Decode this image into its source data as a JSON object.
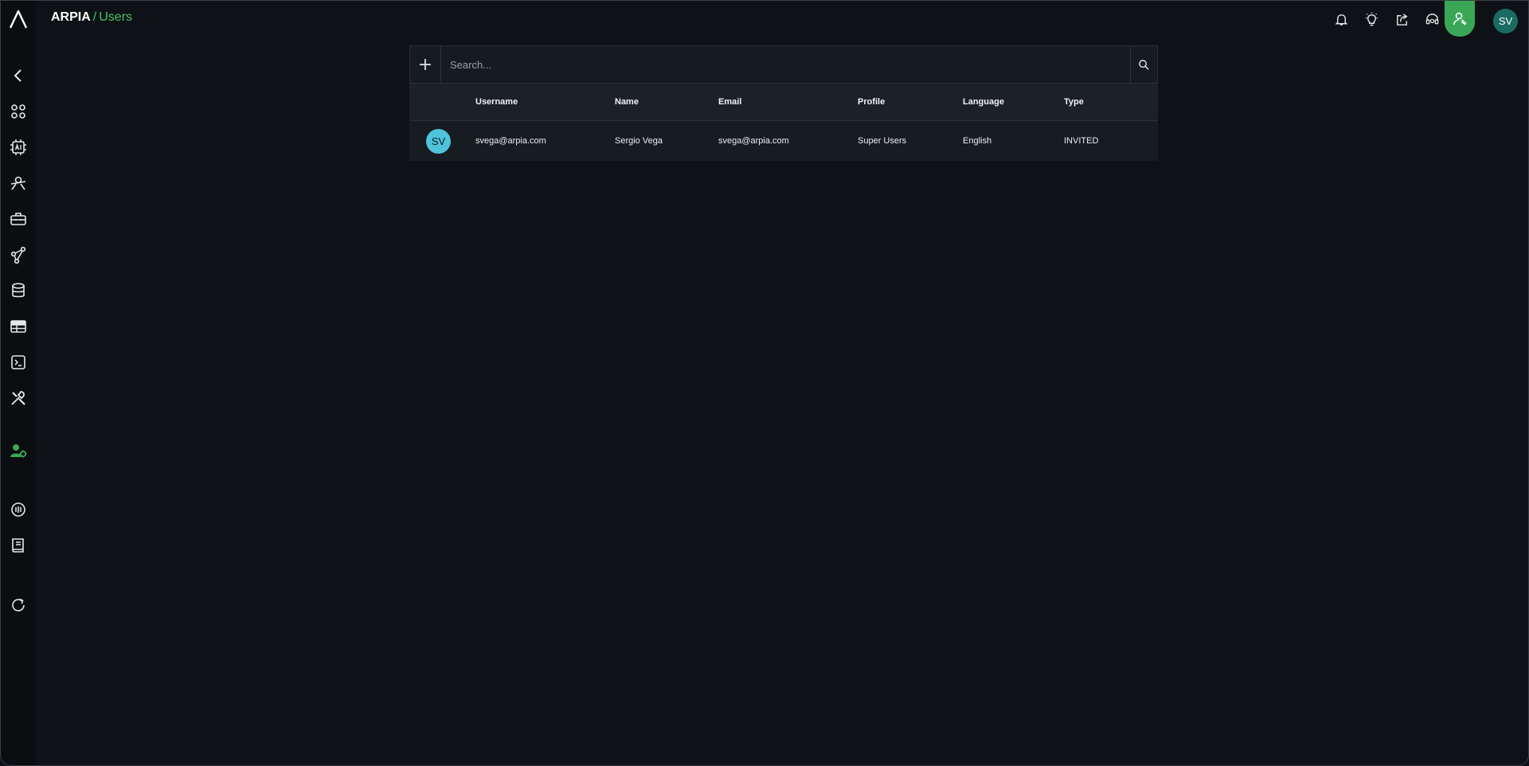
{
  "header": {
    "app_name": "ARPIA",
    "separator": "/",
    "page_name": "Users",
    "user_initials": "SV"
  },
  "accent_color": "#3aa757",
  "sidebar": {
    "items": [
      {
        "icon": "chevron-left-icon"
      },
      {
        "icon": "apps-grid-icon"
      },
      {
        "icon": "ai-chip-icon"
      },
      {
        "icon": "user-network-icon"
      },
      {
        "icon": "toolbox-icon"
      },
      {
        "icon": "graph-nodes-icon"
      },
      {
        "icon": "database-icon"
      },
      {
        "icon": "table-icon"
      },
      {
        "icon": "terminal-icon"
      },
      {
        "icon": "tools-icon"
      },
      {
        "icon": "user-settings-icon",
        "active": true
      },
      {
        "icon": "info-circle-icon"
      },
      {
        "icon": "book-icon"
      },
      {
        "icon": "refresh-icon"
      }
    ]
  },
  "topbar": {
    "icons": [
      "bell-icon",
      "lightbulb-icon",
      "share-icon",
      "support-headset-icon",
      "user-admin-icon"
    ]
  },
  "search": {
    "placeholder": "Search...",
    "add_label": "+"
  },
  "table": {
    "columns": [
      "",
      "Username",
      "Name",
      "Email",
      "Profile",
      "Language",
      "Type"
    ],
    "rows": [
      {
        "initials": "SV",
        "username": "svega@arpia.com",
        "name": "Sergio Vega",
        "email": "svega@arpia.com",
        "profile": "Super Users",
        "language": "English",
        "type": "INVITED"
      }
    ]
  }
}
